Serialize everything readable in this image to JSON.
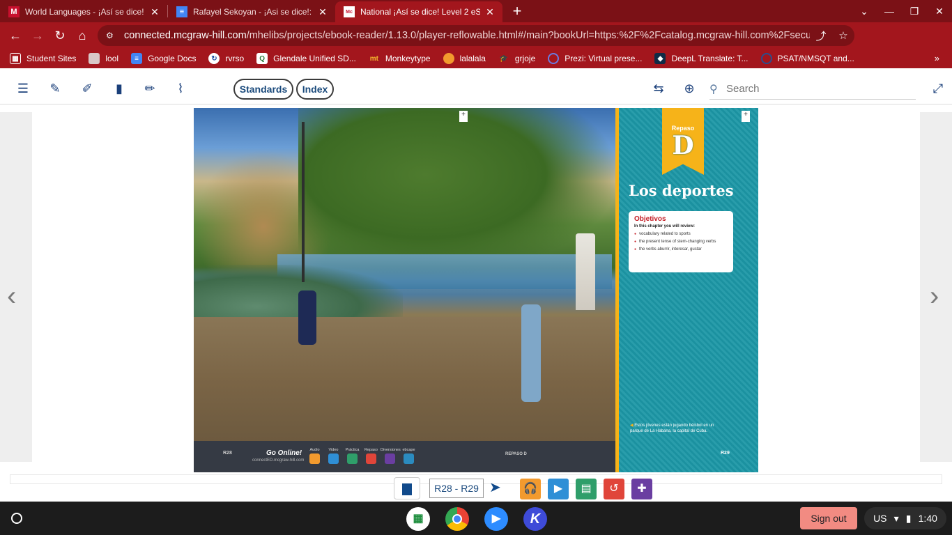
{
  "browser": {
    "tabs": [
      {
        "title": "World Languages - ¡Así se dice! L",
        "favicon_text": "M",
        "active": false
      },
      {
        "title": "Rafayel Sekoyan - ¡Asi se dice!: C",
        "favicon_text": "≡",
        "active": false
      },
      {
        "title": "National ¡Así se dice! Level 2 eSt",
        "favicon_text": "Mc",
        "active": true
      }
    ],
    "new_tab_label": "+",
    "url_domain": "connected.mcgraw-hill.com",
    "url_path": "/mhelibs/projects/ebook-reader/1.13.0/player-reflowable.html#/main?bookUrl=https:%2F%2Fcatalog.mcgraw-hill.com%2Fsecur…",
    "bookmarks": [
      {
        "label": "Student Sites",
        "icon": "grid-icon"
      },
      {
        "label": "lool",
        "icon": "folder-icon"
      },
      {
        "label": "Google Docs",
        "icon": "docs-icon"
      },
      {
        "label": "rvrso",
        "icon": "reverso-icon"
      },
      {
        "label": "Glendale Unified SD...",
        "icon": "glendale-icon"
      },
      {
        "label": "Monkeytype",
        "icon": "monkeytype-icon"
      },
      {
        "label": "lalalala",
        "icon": "flame-icon"
      },
      {
        "label": "grjoje",
        "icon": "graduation-icon"
      },
      {
        "label": "Prezi: Virtual prese...",
        "icon": "prezi-icon"
      },
      {
        "label": "DeepL Translate: T...",
        "icon": "deepl-icon"
      },
      {
        "label": "PSAT/NMSQT and...",
        "icon": "collegeboard-icon"
      }
    ],
    "bookmarks_more": "»"
  },
  "reader": {
    "standards_label": "Standards",
    "index_label": "Index",
    "search_placeholder": "Search",
    "page_value": "R28 - R29",
    "prev_arrow": "‹",
    "next_arrow": "›"
  },
  "book": {
    "left_page_num": "R28",
    "right_page_num": "R29",
    "go_online": "Go Online!",
    "go_online_url": "connectED.mcgraw-hill.com",
    "online_icons": [
      {
        "label": "Audio",
        "color": "#f29a2e"
      },
      {
        "label": "Video",
        "color": "#2f8fd6"
      },
      {
        "label": "Práctica",
        "color": "#2f9e6a"
      },
      {
        "label": "Repaso",
        "color": "#e0453a"
      },
      {
        "label": "Diversiones",
        "color": "#6a3ea1"
      },
      {
        "label": "ebcape",
        "color": "#2b8bbf"
      }
    ],
    "repaso_footer": "REPASO D",
    "ribbon_label": "Repaso",
    "ribbon_letter": "D",
    "chapter_title": "Los deportes",
    "objectives_title": "Objetivos",
    "objectives_subtitle": "In this chapter you will review:",
    "objectives": [
      "vocabulary related to sports",
      "the present tense of stem-changing verbs",
      "the verbs aburrir, interesar, gustar"
    ],
    "caption": "Estos jóvenes están jugando béisbol en un parque de La Habana, la capital de Cuba."
  },
  "shelf": {
    "sign_out": "Sign out",
    "locale": "US",
    "time": "1:40"
  }
}
